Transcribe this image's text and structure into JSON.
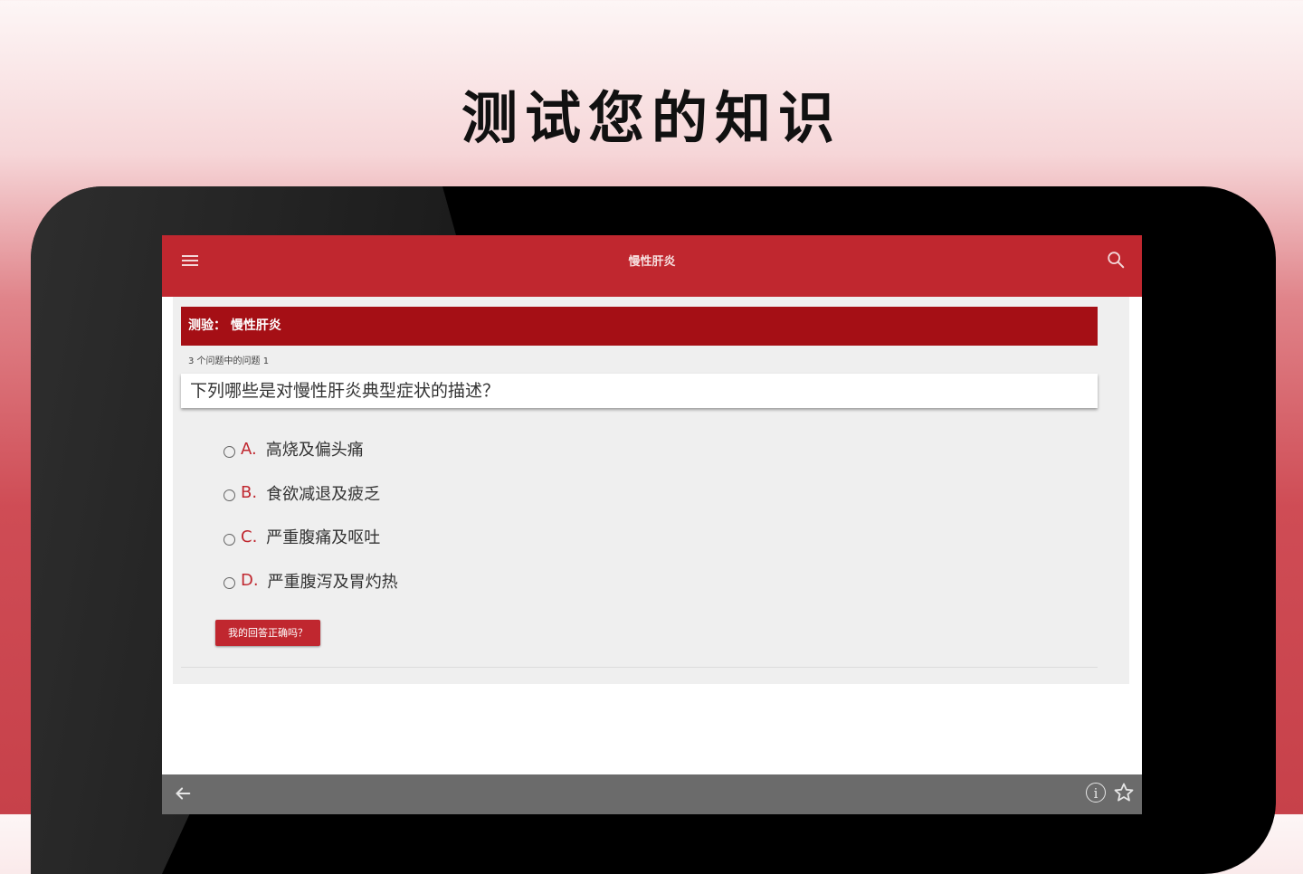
{
  "headline": "测试您的知识",
  "app": {
    "title": "慢性肝炎",
    "icons": {
      "menu": "menu-icon",
      "search": "search-icon",
      "back": "back-arrow-icon",
      "info": "info-icon",
      "favorite": "star-icon"
    }
  },
  "quiz": {
    "banner": "测验： 慢性肝炎",
    "progress": "3 个问题中的问题 1",
    "question": "下列哪些是对慢性肝炎典型症状的描述？",
    "options": [
      {
        "letter": "A.",
        "text": "高烧及偏头痛"
      },
      {
        "letter": "B.",
        "text": "食欲减退及疲乏"
      },
      {
        "letter": "C.",
        "text": "严重腹痛及呕吐"
      },
      {
        "letter": "D.",
        "text": "严重腹泻及胃灼热"
      }
    ],
    "check_button": "我的回答正确吗？"
  },
  "bottom_bar": {
    "info_glyph": "i"
  },
  "colors": {
    "accent": "#c0272f",
    "banner": "#a50f15",
    "bottom_bar": "#6b6b6b"
  }
}
